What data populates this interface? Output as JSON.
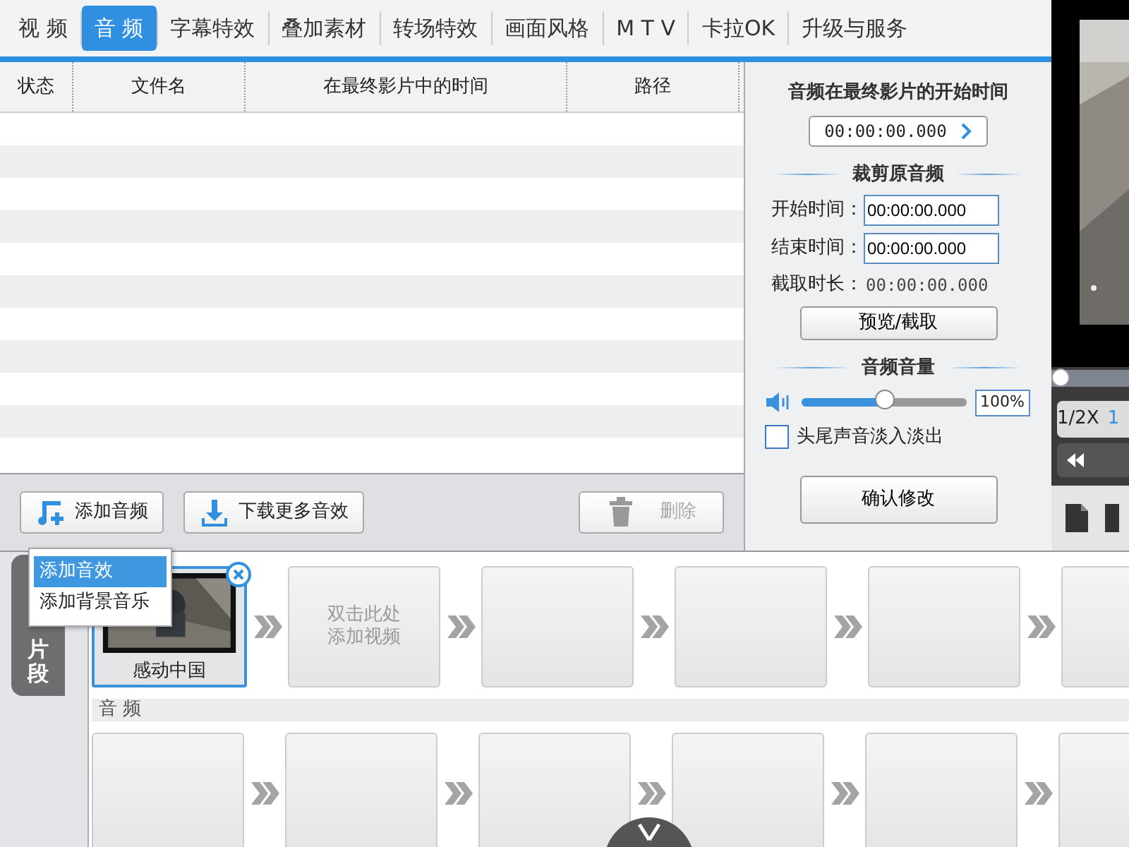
{
  "tabs": [
    {
      "label": "视 频",
      "selected": false
    },
    {
      "label": "音 频",
      "selected": true
    },
    {
      "label": "字幕特效",
      "selected": false
    },
    {
      "label": "叠加素材",
      "selected": false
    },
    {
      "label": "转场特效",
      "selected": false
    },
    {
      "label": "画面风格",
      "selected": false
    },
    {
      "label": "M T V",
      "selected": false
    },
    {
      "label": "卡拉OK",
      "selected": false
    },
    {
      "label": "升级与服务",
      "selected": false
    }
  ],
  "file_table": {
    "columns": [
      "状态",
      "文件名",
      "在最终影片中的时间",
      "路径"
    ]
  },
  "toolbar": {
    "buttons": [
      {
        "kind": "add",
        "label": "添加音频",
        "disabled": false
      },
      {
        "kind": "download",
        "label": "下载更多音效",
        "disabled": false
      },
      {
        "kind": "delete",
        "label": "删除",
        "disabled": true
      }
    ]
  },
  "add_menu": {
    "items": [
      {
        "label": "添加音效",
        "selected": true
      },
      {
        "label": "添加背景音乐",
        "selected": false
      }
    ]
  },
  "audio_settings": {
    "start_title": "音频在最终影片的开始时间",
    "start_value": "00:00:00.000",
    "trim_title": "裁剪原音频",
    "fields": [
      {
        "label": "开始时间：",
        "value": "00:00:00.000"
      },
      {
        "label": "结束时间：",
        "value": "00:00:00.000"
      }
    ],
    "duration_label": "截取时长：",
    "duration_value": "00:00:00.000",
    "preview_button": "预览/截取",
    "volume_title": "音频音量",
    "volume": {
      "level": 0.51,
      "reading": "100%"
    },
    "fade": {
      "label": "头尾声音淡入淡出",
      "checked": false
    },
    "confirm_button": "确认修改"
  },
  "preview": {
    "progress": {
      "level": 0
    },
    "speed": "1/2X",
    "speed_2": "1"
  },
  "timeline": {
    "side_tab": "片段",
    "video_slots": [
      {
        "kind": "clip",
        "title": "感动中国",
        "selected": true
      },
      {
        "kind": "hint",
        "hint": "双击此处添加视频"
      },
      {
        "kind": "empty"
      },
      {
        "kind": "empty"
      },
      {
        "kind": "empty"
      },
      {
        "kind": "empty"
      }
    ],
    "audio_label": "音 频",
    "audio_slots": [
      {
        "kind": "empty"
      },
      {
        "kind": "empty"
      },
      {
        "kind": "empty"
      },
      {
        "kind": "empty"
      },
      {
        "kind": "empty"
      },
      {
        "kind": "empty"
      }
    ]
  }
}
